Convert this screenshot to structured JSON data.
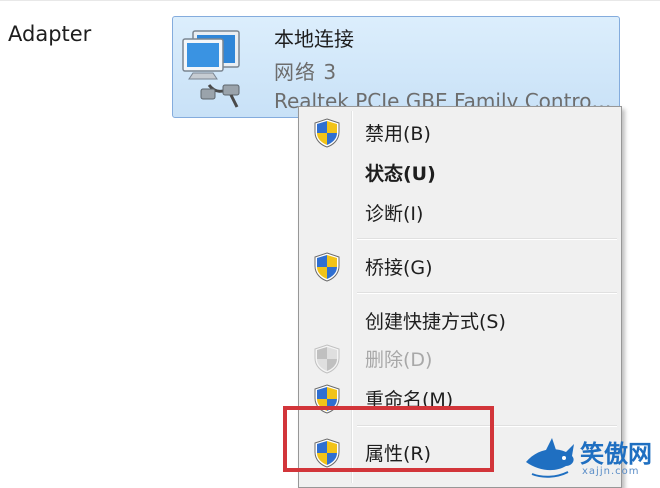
{
  "adapter_label": "Adapter",
  "tile": {
    "name": "本地连接",
    "network": "网络 3",
    "device": "Realtek PCIe GBE Family Controller"
  },
  "menu": {
    "items": [
      {
        "label": "禁用(B)",
        "icon": "uac-shield-icon",
        "style": "normal"
      },
      {
        "label": "状态(U)",
        "icon": "",
        "style": "bold"
      },
      {
        "label": "诊断(I)",
        "icon": "",
        "style": "normal"
      },
      {
        "label": "桥接(G)",
        "icon": "uac-shield-icon",
        "style": "normal"
      },
      {
        "label": "创建快捷方式(S)",
        "icon": "",
        "style": "normal"
      },
      {
        "label": "删除(D)",
        "icon": "uac-shield-icon",
        "style": "disabled"
      },
      {
        "label": "重命名(M)",
        "icon": "uac-shield-icon",
        "style": "normal"
      },
      {
        "label": "属性(R)",
        "icon": "uac-shield-icon",
        "style": "normal"
      }
    ]
  },
  "highlight_color": "#d2353a",
  "watermark": {
    "title": "笑傲网",
    "url": "xajjn.com"
  }
}
